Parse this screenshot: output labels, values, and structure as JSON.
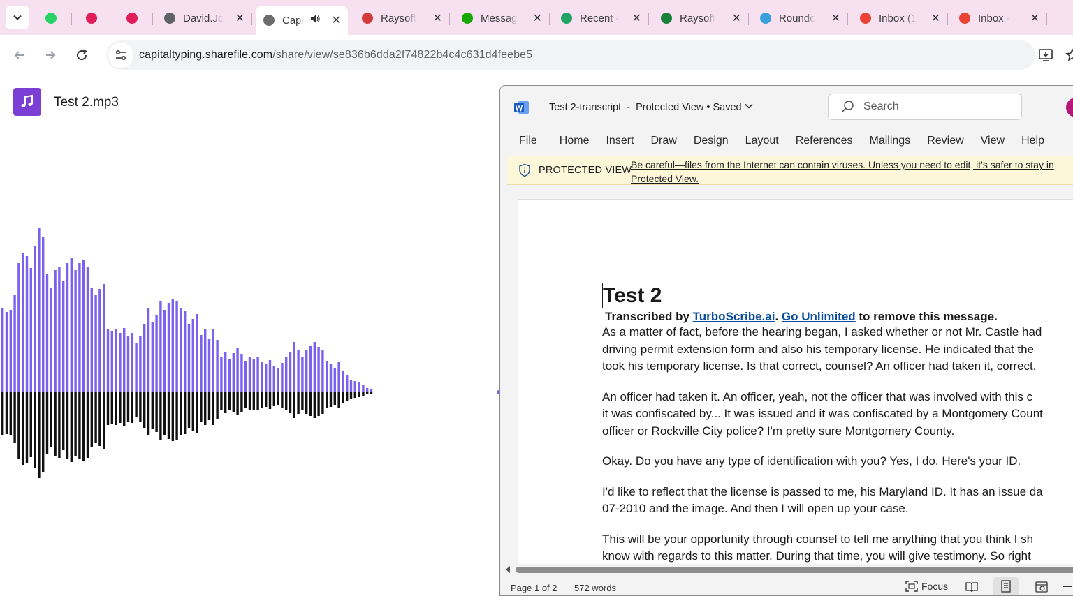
{
  "browser": {
    "tabs": [
      {
        "title": "",
        "icon": "whatsapp-icon",
        "color": "#25d366"
      },
      {
        "title": "",
        "icon": "slack-icon",
        "color": "#e01e5a"
      },
      {
        "title": "",
        "icon": "slack-icon",
        "color": "#e01e5a"
      },
      {
        "title": "David.Jc",
        "icon": "globe-icon",
        "color": "#5f6368"
      },
      {
        "title": "Capi",
        "icon": "sharefile-icon",
        "color": "#6d6d6d",
        "active": true,
        "audio": true
      },
      {
        "title": "Raysoft",
        "icon": "raysoft-icon",
        "color": "#d43c3c"
      },
      {
        "title": "Messag",
        "icon": "upwork-icon",
        "color": "#14a800"
      },
      {
        "title": "Recent -",
        "icon": "google-drive-icon",
        "color": "#1fa463"
      },
      {
        "title": "Raysoft",
        "icon": "google-sheets-icon",
        "color": "#188038"
      },
      {
        "title": "Roundc",
        "icon": "roundcube-icon",
        "color": "#37a0dc"
      },
      {
        "title": "Inbox (1",
        "icon": "gmail-icon",
        "color": "#ea4335"
      },
      {
        "title": "Inbox -",
        "icon": "gmail-icon",
        "color": "#ea4335"
      }
    ],
    "url_host": "capitaltyping.sharefile.com",
    "url_path": "/share/view/se836b6dda2f74822b4c4c631d4feebe5"
  },
  "player": {
    "filename": "Test 2.mp3",
    "accent_color": "#7b3fd6",
    "wave_color": "#7a62f0"
  },
  "word": {
    "doc_title": "Test 2-transcript",
    "doc_status": "Protected View • Saved",
    "search_placeholder": "Search",
    "menu": [
      "File",
      "Home",
      "Insert",
      "Draw",
      "Design",
      "Layout",
      "References",
      "Mailings",
      "Review",
      "View",
      "Help"
    ],
    "banner_label": "PROTECTED VIEW",
    "banner_message": "Be careful—files from the Internet can contain viruses. Unless you need to edit, it's safer to stay in Protected View.",
    "document": {
      "heading": "Test 2",
      "credit_prefix": "Transcribed by ",
      "credit_link1": "TurboScribe.ai",
      "credit_mid": ". ",
      "credit_link2": "Go Unlimited",
      "credit_suffix": " to remove this message.",
      "paragraphs": [
        [
          "As a matter of fact, before the hearing began, I asked whether or not Mr. Castle had",
          "driving permit extension form and also his temporary license. He indicated that the",
          "took his temporary license. Is that correct, counsel? An officer had taken it, correct."
        ],
        [
          "An officer had taken it. An officer, yeah, not the officer that was involved with this c",
          "it was confiscated by... It was issued and it was confiscated by a Montgomery Count",
          "officer or Rockville City police? I'm pretty sure Montgomery County."
        ],
        [
          "Okay. Do you have any type of identification with you? Yes, I do. Here's your ID."
        ],
        [
          "I'd like to reflect that the license is passed to me, his Maryland ID. It has an issue da",
          "07-2010 and the image. And then I will open up your case."
        ],
        [
          "This will be your opportunity through counsel to tell me anything that you think I sh",
          "know with regards to this matter. During that time, you will give testimony. So right"
        ]
      ]
    },
    "status": {
      "page": "Page 1 of 2",
      "words": "572 words",
      "focus": "Focus"
    }
  }
}
